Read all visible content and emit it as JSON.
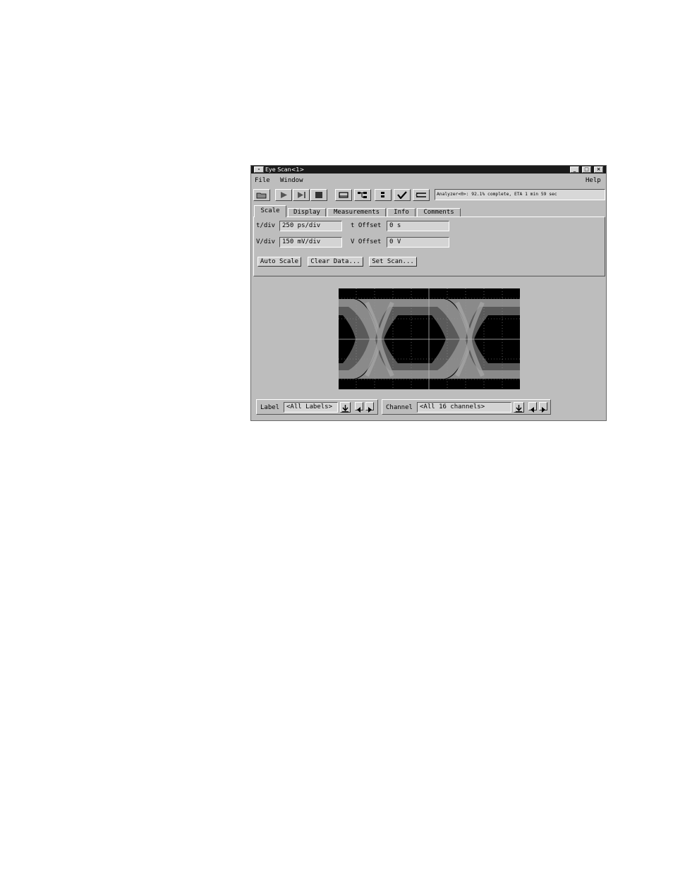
{
  "window": {
    "title": "Eye Scan<1>",
    "controls": {
      "menu": "-",
      "minimize": "_",
      "maximize": "□",
      "close": "×"
    }
  },
  "menubar": {
    "file": "File",
    "window": "Window",
    "help": "Help"
  },
  "toolbar": {
    "icons": [
      "open-icon",
      "run-icon",
      "run-repetitive-icon",
      "stop-icon",
      "display-icon",
      "bus-icon",
      "channel-icon",
      "check-icon",
      "settings-icon"
    ],
    "status": "Analyzer<0>:  92.1% complete, ETA 1 min 59 sec"
  },
  "tabs": [
    {
      "label": "Scale",
      "active": true
    },
    {
      "label": "Display",
      "active": false
    },
    {
      "label": "Measurements",
      "active": false
    },
    {
      "label": "Info",
      "active": false
    },
    {
      "label": "Comments",
      "active": false
    }
  ],
  "scale": {
    "tdiv_label": "t/div",
    "tdiv_value": "250 ps/div",
    "vdiv_label": "V/div",
    "vdiv_value": "150 mV/div",
    "toffset_label": "t Offset",
    "toffset_value": "0 s",
    "voffset_label": "V Offset",
    "voffset_value": "0 V"
  },
  "buttons": {
    "auto_scale": "Auto Scale",
    "clear_data": "Clear Data...",
    "set_scan": "Set Scan..."
  },
  "bottom": {
    "label_label": "Label",
    "label_value": "<All Labels>",
    "channel_label": "Channel",
    "channel_value": "<All 16 channels>"
  },
  "colors": {
    "window_bg": "#bdbdbd",
    "titlebar": "#1a1a1a",
    "eye_bg": "#000000",
    "eye_outer": "#8a8a8a",
    "eye_inner": "#5a5a5a"
  }
}
